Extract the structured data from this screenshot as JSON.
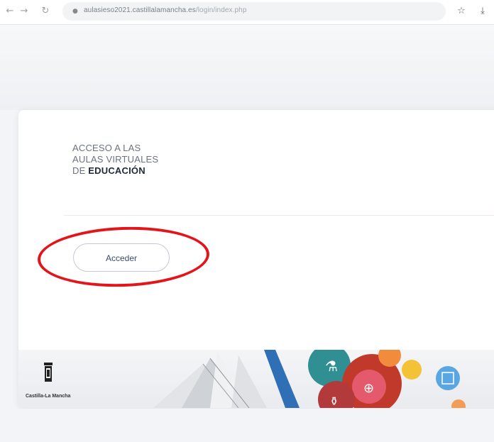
{
  "browser": {
    "back_icon": "back-arrow-icon",
    "forward_icon": "forward-arrow-icon",
    "reload_icon": "reload-icon",
    "url_host": "aulasieso2021.castillalamancha.es",
    "url_path": "/login/index.php",
    "bookmark_icon": "star-icon",
    "download_icon": "download-icon"
  },
  "login": {
    "heading_line1": "ACCESO A LAS",
    "heading_line2": "AULAS VIRTUALES",
    "heading_line3_prefix": "DE",
    "heading_line3_strong": "EDUCACIÓN",
    "button_label": "Acceder"
  },
  "footer": {
    "logo_text": "Castilla-La Mancha"
  },
  "colors": {
    "highlight": "#e3151a",
    "button_text": "#3c4a6e",
    "page_background": "#f3f4f7"
  }
}
